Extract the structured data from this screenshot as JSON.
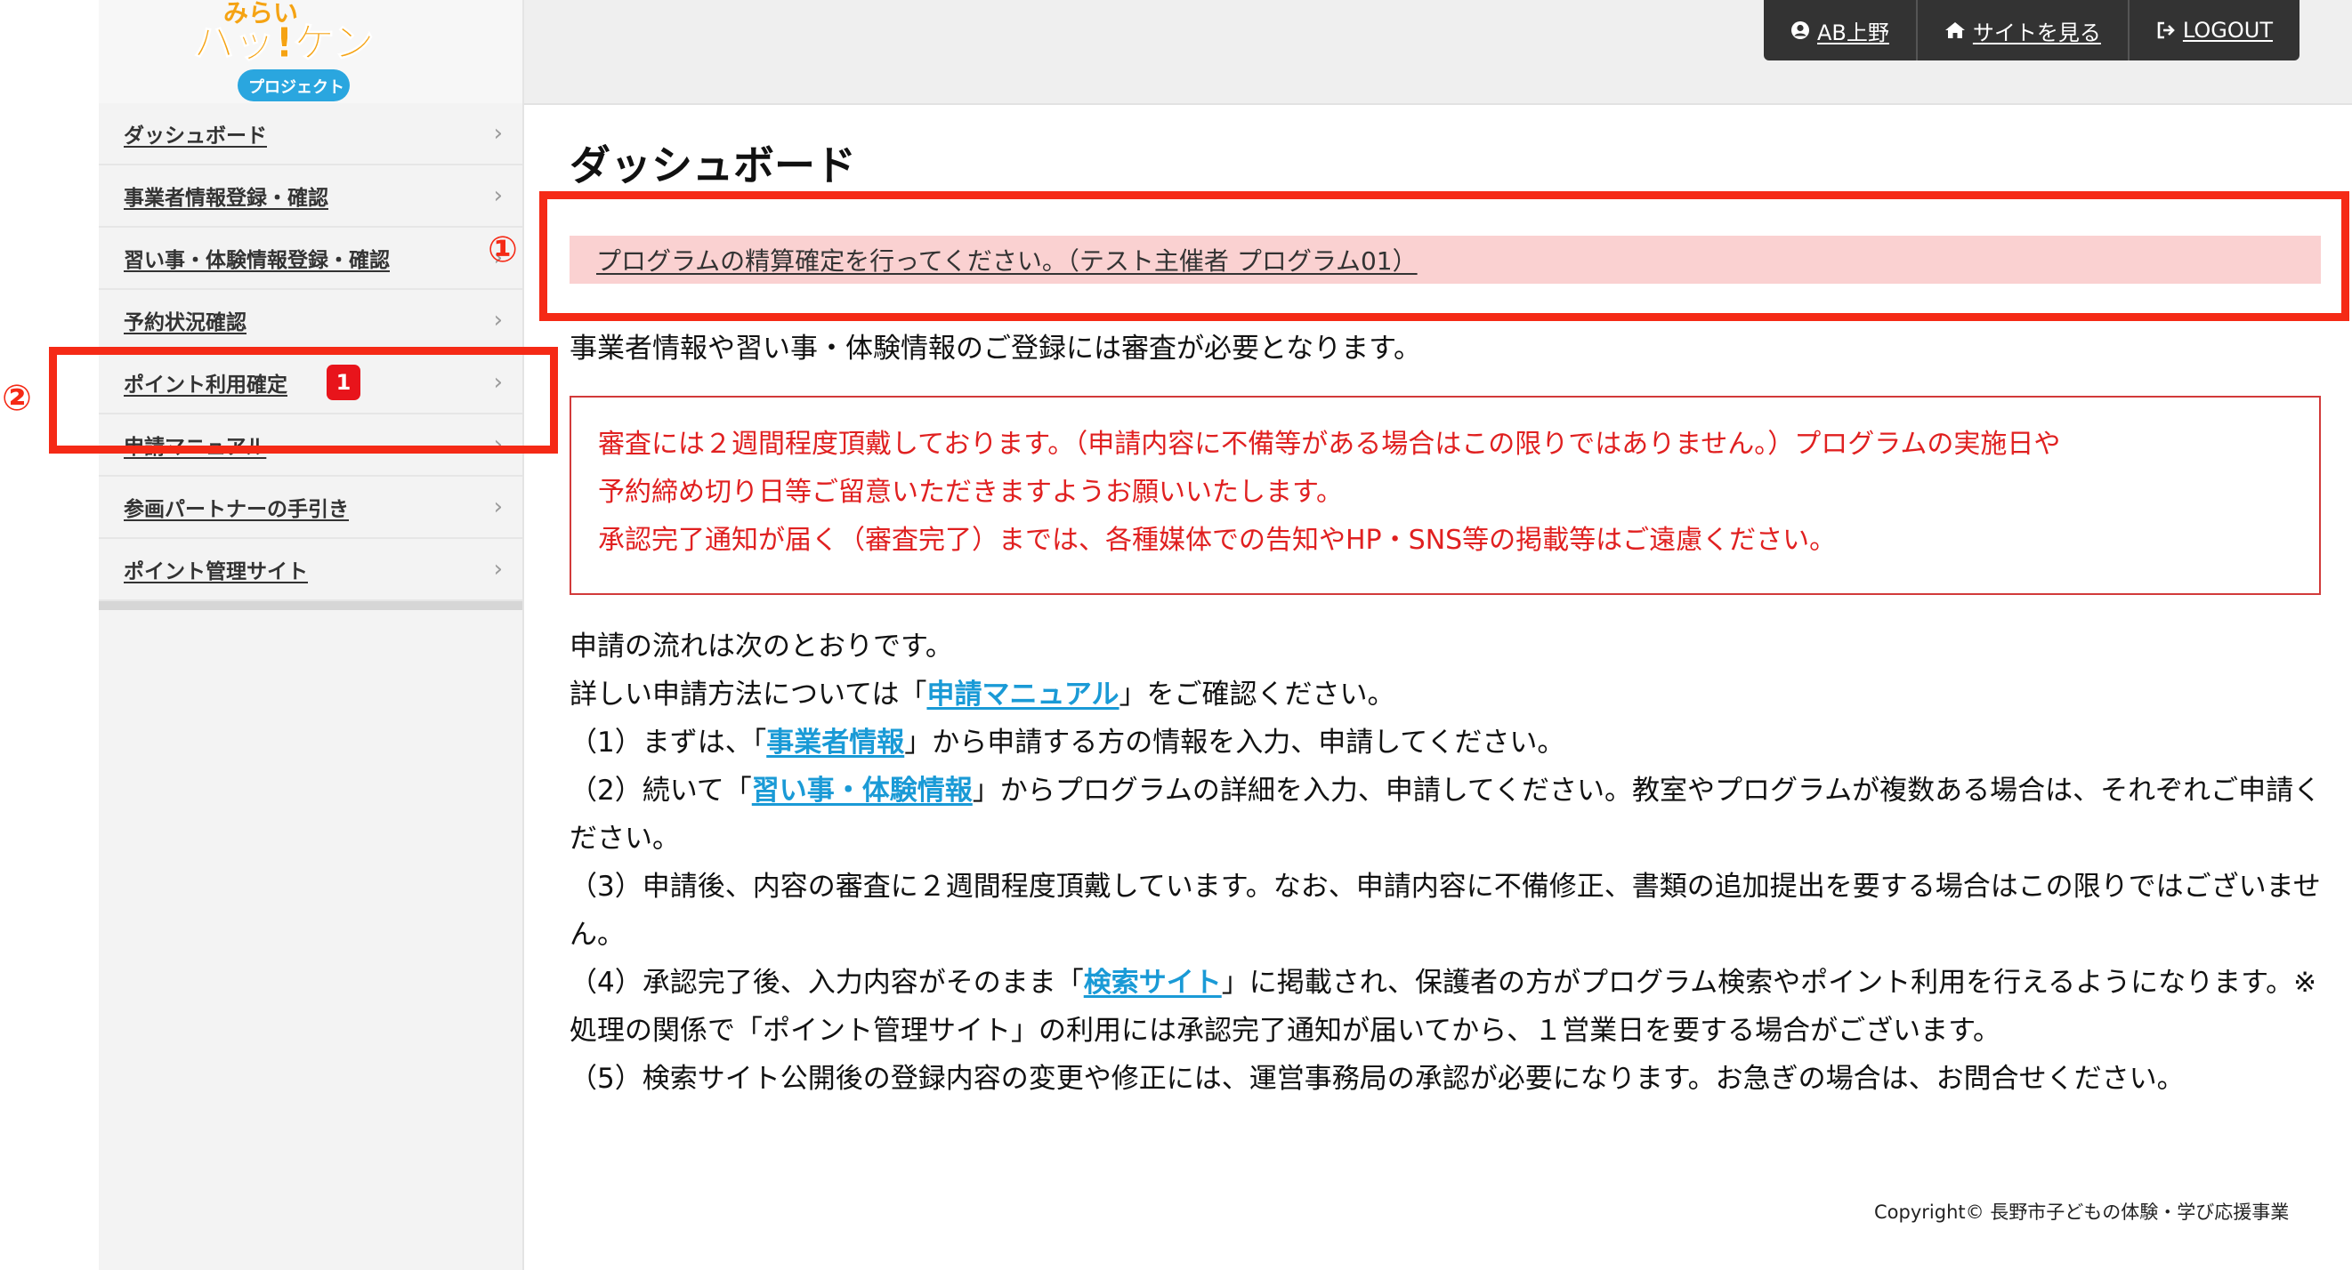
{
  "logo": {
    "line1": "みらい",
    "line2": "ハッ!ケン",
    "line3": "プロジェクト"
  },
  "sidebar": {
    "items": [
      {
        "label": "ダッシュボード"
      },
      {
        "label": "事業者情報登録・確認"
      },
      {
        "label": "習い事・体験情報登録・確認"
      },
      {
        "label": "予約状況確認"
      },
      {
        "label": "ポイント利用確定",
        "badge": "1"
      },
      {
        "label": "申請マニュアル"
      },
      {
        "label": "参画パートナーの手引き"
      },
      {
        "label": "ポイント管理サイト"
      }
    ],
    "chevron": "›"
  },
  "header": {
    "user": "AB上野",
    "view_site": "サイトを見る",
    "logout": "LOGOUT",
    "icons": {
      "user": "user-circle-icon",
      "home": "home-icon",
      "logout": "sign-out-icon"
    }
  },
  "main": {
    "title": "ダッシュボード",
    "alert": "プログラムの精算確定を行ってください。（テスト主催者 プログラム01）",
    "intro": "事業者情報や習い事・体験情報のご登録には審査が必要となります。",
    "notice": [
      "審査には２週間程度頂戴しております。（申請内容に不備等がある場合はこの限りではありません。）プログラムの実施日や",
      "予約締め切り日等ご留意いただきますようお願いいたします。",
      "承認完了通知が届く（審査完了）までは、各種媒体での告知やHP・SNS等の掲載等はご遠慮ください。"
    ],
    "flow": {
      "line1": "申請の流れは次のとおりです。",
      "line2_pre": "詳しい申請方法については「",
      "line2_link": "申請マニュアル",
      "line2_post": "」をご確認ください。",
      "s1_pre": "（1）まずは、「",
      "s1_link": "事業者情報",
      "s1_post": "」から申請する方の情報を入力、申請してください。",
      "s2_pre": "（2）続いて「",
      "s2_link": "習い事・体験情報",
      "s2_post": "」からプログラムの詳細を入力、申請してください。教室やプログラムが複数ある場合は、それぞれご申請ください。",
      "s3": "（3）申請後、内容の審査に２週間程度頂戴しています。なお、申請内容に不備修正、書類の追加提出を要する場合はこの限りではございません。",
      "s4_pre": "（4）承認完了後、入力内容がそのまま「",
      "s4_link": "検索サイト",
      "s4_post": "」に掲載され、保護者の方がプログラム検索やポイント利用を行えるようになります。※処理の関係で「ポイント管理サイト」の利用には承認完了通知が届いてから、１営業日を要する場合がございます。",
      "s5": "（5）検索サイト公開後の登録内容の変更や修正には、運営事務局の承認が必要になります。お急ぎの場合は、お問合せください。"
    }
  },
  "footer": {
    "copyright": "Copyright© 長野市子どもの体験・学び応援事業"
  },
  "annotations": {
    "one": "①",
    "two": "②",
    "color": "#f52a16"
  }
}
